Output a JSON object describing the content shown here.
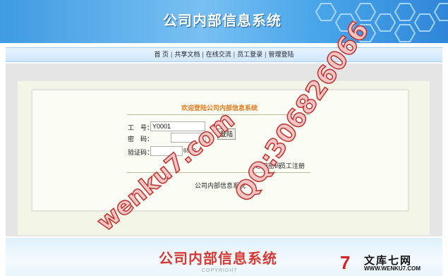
{
  "header": {
    "title": "公司内部信息系统"
  },
  "nav": {
    "items": [
      "首 页",
      "共享文档",
      "在线交流",
      "员工登录",
      "管理登陆"
    ],
    "separator": "|"
  },
  "login": {
    "title": "欢迎登陆公司内部信息系统",
    "employee_id_label": "工　号：",
    "employee_id_value": "Y0001",
    "password_label": "密　码：",
    "captcha_label": "验证码：",
    "captcha_code": "6550",
    "login_button": "登陆",
    "forgot_password": "忘记密码",
    "register": "员工注册",
    "footer": "公司内部信息系统"
  },
  "bottom": {
    "title": "公司内部信息系统",
    "copyright": "COPYRIGHT"
  },
  "watermarks": {
    "site": "wenku7.com",
    "qq": "QQ:306826066"
  },
  "logo": {
    "mark": "7",
    "name": "文库七网",
    "url": "WWW.WENKU7.COM"
  },
  "colors": {
    "banner": "#4aa6ea",
    "title_orange": "#e07a1c",
    "bottom_title_red": "#d63a34",
    "watermark": "#c2312d"
  }
}
